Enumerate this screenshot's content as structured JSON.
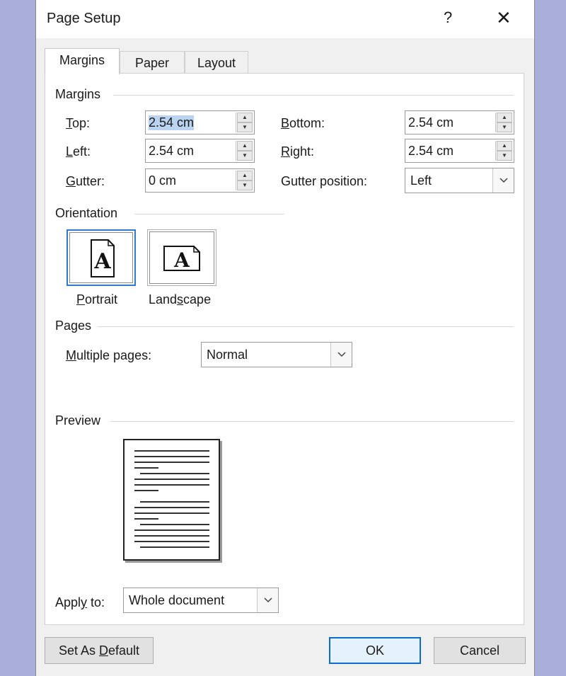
{
  "dialog": {
    "title": "Page Setup",
    "help_glyph": "?",
    "close_glyph": "✕"
  },
  "tabs": [
    {
      "label": "Margins"
    },
    {
      "label": "Paper"
    },
    {
      "label": "Layout"
    }
  ],
  "margins": {
    "section_label": "Margins",
    "top": {
      "label": "Top:",
      "value": "2.54 cm"
    },
    "bottom": {
      "label": "Bottom:",
      "value": "2.54 cm"
    },
    "left": {
      "label": "Left:",
      "value": "2.54 cm"
    },
    "right": {
      "label": "Right:",
      "value": "2.54 cm"
    },
    "gutter": {
      "label": "Gutter:",
      "value": "0 cm"
    },
    "gutter_position": {
      "label": "Gutter position:",
      "value": "Left"
    }
  },
  "orientation": {
    "section_label": "Orientation",
    "portrait_label": "Portrait",
    "landscape_label": "Landscape",
    "icon_letter": "A"
  },
  "pages": {
    "section_label": "Pages",
    "multiple_label": "Multiple pages:",
    "multiple_value": "Normal"
  },
  "preview": {
    "section_label": "Preview"
  },
  "apply_to": {
    "label": "Apply to:",
    "value": "Whole document"
  },
  "buttons": {
    "set_default": "Set As Default",
    "ok": "OK",
    "cancel": "Cancel"
  },
  "colors": {
    "background": "#a9aedb",
    "accent": "#2e7bd1",
    "selection": "#b9d3f1"
  }
}
